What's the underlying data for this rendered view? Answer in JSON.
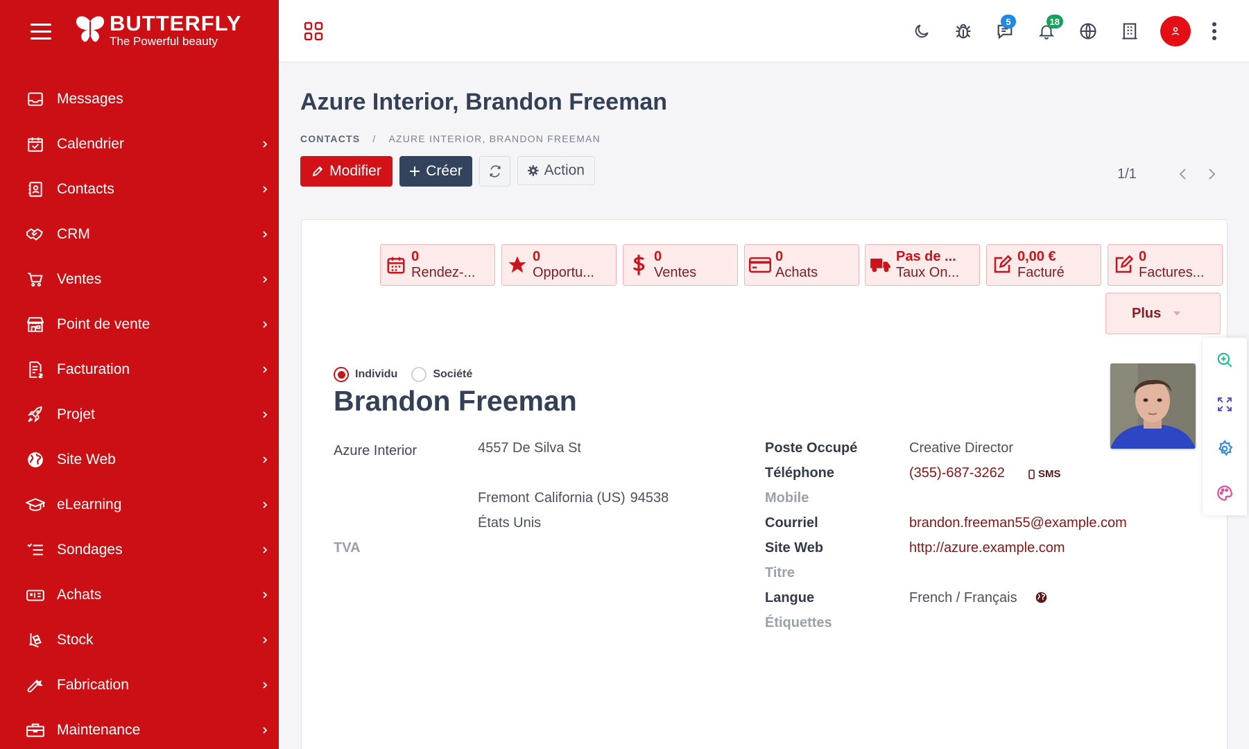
{
  "brand": {
    "title": "BUTTERFLY",
    "subtitle": "The Powerful beauty"
  },
  "sidebar": {
    "items": [
      {
        "label": "Messages",
        "icon": "inbox-icon",
        "has_chevron": false
      },
      {
        "label": "Calendrier",
        "icon": "calendar-icon",
        "has_chevron": true
      },
      {
        "label": "Contacts",
        "icon": "contact-card-icon",
        "has_chevron": true
      },
      {
        "label": "CRM",
        "icon": "handshake-icon",
        "has_chevron": true
      },
      {
        "label": "Ventes",
        "icon": "cart-icon",
        "has_chevron": true
      },
      {
        "label": "Point de vente",
        "icon": "store-icon",
        "has_chevron": true
      },
      {
        "label": "Facturation",
        "icon": "invoice-icon",
        "has_chevron": true
      },
      {
        "label": "Projet",
        "icon": "rocket-icon",
        "has_chevron": true
      },
      {
        "label": "Site Web",
        "icon": "globe-icon",
        "has_chevron": true
      },
      {
        "label": "eLearning",
        "icon": "graduation-cap-icon",
        "has_chevron": true
      },
      {
        "label": "Sondages",
        "icon": "survey-list-icon",
        "has_chevron": true
      },
      {
        "label": "Achats",
        "icon": "purchase-icon",
        "has_chevron": true
      },
      {
        "label": "Stock",
        "icon": "stock-icon",
        "has_chevron": true
      },
      {
        "label": "Fabrication",
        "icon": "wrench-icon",
        "has_chevron": true
      },
      {
        "label": "Maintenance",
        "icon": "toolbox-icon",
        "has_chevron": true
      }
    ]
  },
  "topbar": {
    "chat_badge": "5",
    "notifications_badge": "18"
  },
  "header": {
    "title": "Azure Interior, Brandon Freeman",
    "breadcrumb": {
      "root": "CONTACTS",
      "separator": "/",
      "current": "AZURE INTERIOR, BRANDON FREEMAN"
    },
    "buttons": {
      "edit": "Modifier",
      "create": "Créer",
      "action": "Action"
    },
    "pager": "1/1"
  },
  "smart_buttons": [
    {
      "value": "0",
      "label": "Rendez-...",
      "icon": "calendar-icon"
    },
    {
      "value": "0",
      "label": "Opportu...",
      "icon": "star-icon"
    },
    {
      "value": "0",
      "label": "Ventes",
      "icon": "dollar-icon"
    },
    {
      "value": "0",
      "label": "Achats",
      "icon": "credit-card-icon"
    },
    {
      "value": "Pas de ...",
      "label": "Taux On...",
      "icon": "truck-icon"
    },
    {
      "value": "0,00 €",
      "label": "Facturé",
      "icon": "edit-icon"
    },
    {
      "value": "0",
      "label": "Factures...",
      "icon": "edit-icon"
    }
  ],
  "more_label": "Plus",
  "form": {
    "type_individual": "Individu",
    "type_company": "Société",
    "name": "Brandon Freeman",
    "company": "Azure Interior",
    "address": {
      "street": "4557 De Silva St",
      "city": "Fremont",
      "state": "California (US)",
      "zip": "94538",
      "country": "États Unis"
    },
    "vat_label": "TVA",
    "fields": {
      "job_label": "Poste Occupé",
      "job_value": "Creative Director",
      "phone_label": "Téléphone",
      "phone_value": "(355)-687-3262",
      "sms_label": "SMS",
      "mobile_label": "Mobile",
      "email_label": "Courriel",
      "email_value": "brandon.freeman55@example.com",
      "website_label": "Site Web",
      "website_value": "http://azure.example.com",
      "title_label": "Titre",
      "lang_label": "Langue",
      "lang_value": "French / Français",
      "tags_label": "Étiquettes"
    }
  },
  "colors": {
    "primary": "#cc0f14",
    "dark_button": "#33435d",
    "smart_bg": "#fdeaea",
    "link": "#8a1414"
  }
}
